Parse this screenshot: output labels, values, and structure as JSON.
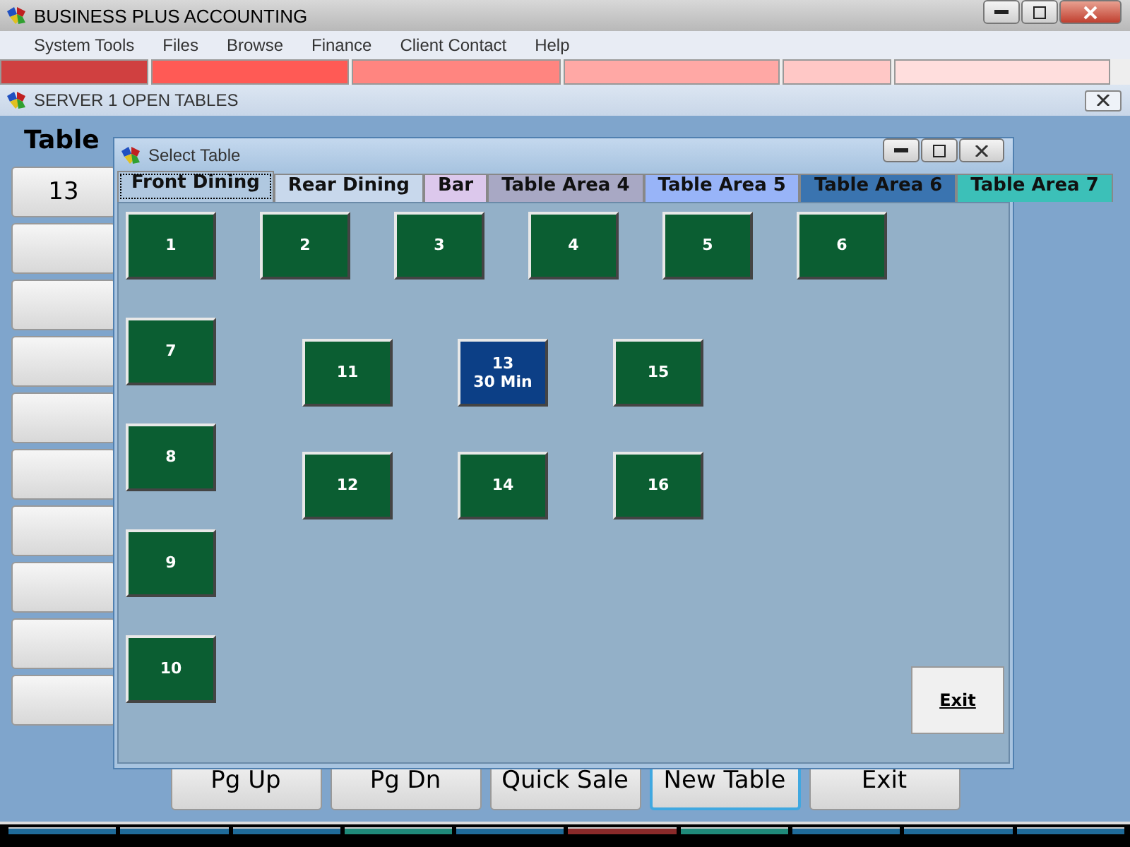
{
  "window": {
    "title": "BUSINESS PLUS ACCOUNTING"
  },
  "menu": [
    "System Tools",
    "Files",
    "Browse",
    "Finance",
    "Client Contact",
    "Help"
  ],
  "category_tabs": [
    {
      "color": "#d04040"
    },
    {
      "color": "#ff5a55"
    },
    {
      "color": "#ff8580"
    },
    {
      "color": "#ffa8a5"
    },
    {
      "color": "#ffc8c6"
    },
    {
      "color": "#ffdedd"
    }
  ],
  "open_tables": {
    "title": "SERVER 1  OPEN TABLES",
    "header": "Table",
    "rows": [
      {
        "table": "13"
      },
      {
        "table": ""
      },
      {
        "table": ""
      },
      {
        "table": ""
      },
      {
        "table": ""
      },
      {
        "table": ""
      },
      {
        "table": ""
      },
      {
        "table": ""
      },
      {
        "table": ""
      },
      {
        "table": ""
      }
    ],
    "buttons": [
      {
        "label": "Pg Up",
        "focused": false
      },
      {
        "label": "Pg Dn",
        "focused": false
      },
      {
        "label": "Quick Sale",
        "focused": false
      },
      {
        "label": "New Table",
        "focused": true
      },
      {
        "label": "Exit",
        "focused": false
      }
    ]
  },
  "status_strip": [
    {
      "color": "#1f6b9a"
    },
    {
      "color": "#1f6b9a"
    },
    {
      "color": "#1f6b9a"
    },
    {
      "color": "#1f8a7a"
    },
    {
      "color": "#1f6b9a"
    },
    {
      "color": "#8a2a2a"
    },
    {
      "color": "#1f8a7a"
    },
    {
      "color": "#1f6b9a"
    },
    {
      "color": "#1f6b9a"
    },
    {
      "color": "#1f6b9a"
    }
  ],
  "dialog": {
    "title": "Select Table",
    "tabs": [
      {
        "label": "Front Dining",
        "selected": true,
        "color": "#b0c8e0"
      },
      {
        "label": "Rear Dining",
        "selected": false,
        "color": "#c8d8ec"
      },
      {
        "label": "Bar",
        "selected": false,
        "color": "#dcc8ec"
      },
      {
        "label": "Table Area 4",
        "selected": false,
        "color": "#a8a8c4"
      },
      {
        "label": "Table Area 5",
        "selected": false,
        "color": "#98b4f8"
      },
      {
        "label": "Table Area 6",
        "selected": false,
        "color": "#3a74b0"
      },
      {
        "label": "Table Area 7",
        "selected": false,
        "color": "#3cc0b8"
      }
    ],
    "tables": [
      {
        "label": "1",
        "occupied": false
      },
      {
        "label": "2",
        "occupied": false
      },
      {
        "label": "3",
        "occupied": false
      },
      {
        "label": "4",
        "occupied": false
      },
      {
        "label": "5",
        "occupied": false
      },
      {
        "label": "6",
        "occupied": false
      },
      {
        "label": "7",
        "occupied": false
      },
      {
        "label": "8",
        "occupied": false
      },
      {
        "label": "9",
        "occupied": false
      },
      {
        "label": "10",
        "occupied": false
      },
      {
        "label": "11",
        "occupied": false
      },
      {
        "label": "12",
        "occupied": false
      },
      {
        "label": "13",
        "occupied": true,
        "time": "30 Min"
      },
      {
        "label": "14",
        "occupied": false
      },
      {
        "label": "15",
        "occupied": false
      },
      {
        "label": "16",
        "occupied": false
      }
    ],
    "exit_button": "Exit"
  }
}
